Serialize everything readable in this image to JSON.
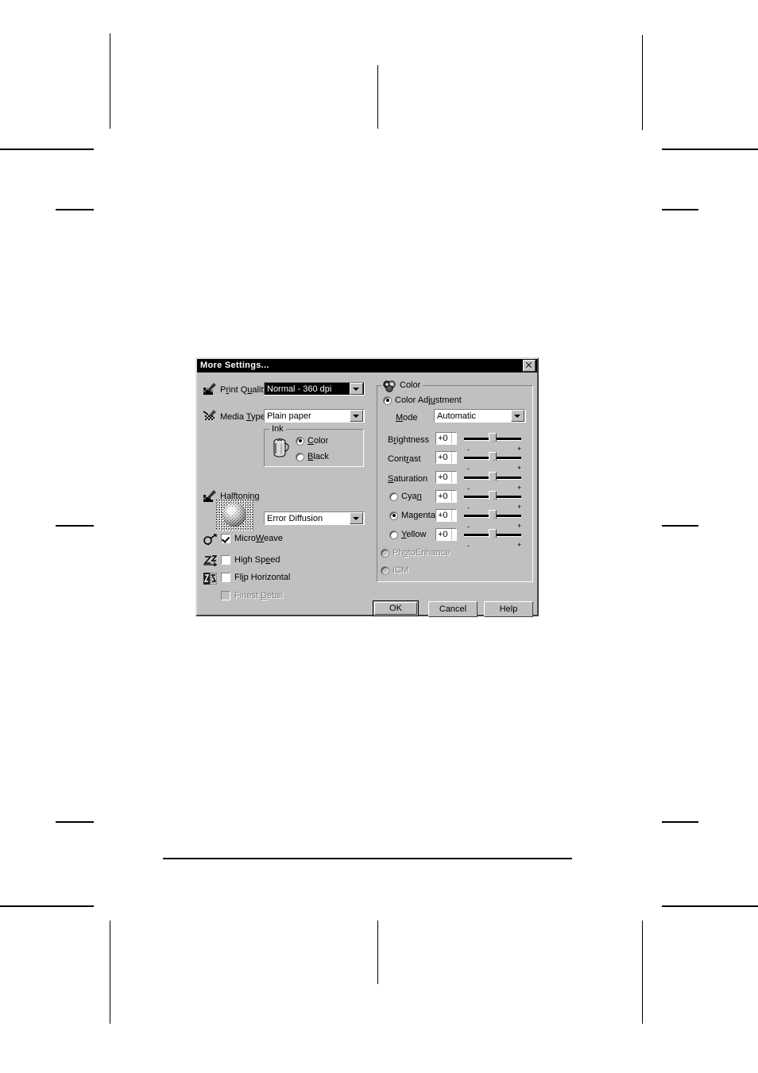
{
  "page": {
    "description": "Printed manual page showing an EPSON printer driver More Settings dialog",
    "background_color": "#ffffff",
    "mark_color": "#000000"
  },
  "dialog": {
    "title": "More Settings...",
    "close_label": "×",
    "background_color": "#c0c0c0",
    "titlebar_color": "#000000",
    "titlebar_text_color": "#ffffff",
    "left_panel": {
      "print_quality": {
        "label": "Print Quality",
        "value": "Normal - 360 dpi",
        "selected": true,
        "icon": "print-quality-icon"
      },
      "media_type": {
        "label": "Media Type",
        "value": "Plain paper",
        "icon": "media-type-icon"
      },
      "ink": {
        "group_label": "Ink",
        "icon": "ink-bottle-icon",
        "options": [
          {
            "label": "Color",
            "checked": true
          },
          {
            "label": "Black",
            "checked": false
          }
        ]
      },
      "halftoning": {
        "label": "Halftoning",
        "value": "Error Diffusion",
        "icon": "halftoning-icon"
      },
      "checkboxes": [
        {
          "label": "MicroWeave",
          "checked": true,
          "disabled": false,
          "icon": "microweave-icon"
        },
        {
          "label": "High Speed",
          "checked": false,
          "disabled": false,
          "icon": "high-speed-icon"
        },
        {
          "label": "Flip Horizontal",
          "checked": false,
          "disabled": false,
          "icon": "flip-horizontal-icon"
        },
        {
          "label": "Finest Detail",
          "checked": false,
          "disabled": true,
          "icon": null
        }
      ]
    },
    "color_panel": {
      "group_label": "Color",
      "group_icon": "color-circles-icon",
      "color_adjustment": {
        "label": "Color Adjustment",
        "checked": true
      },
      "mode": {
        "label": "Mode",
        "value": "Automatic"
      },
      "sliders": [
        {
          "label": "Brightness",
          "value": "+0",
          "kind": "label",
          "minus": "-",
          "plus": "+"
        },
        {
          "label": "Contrast",
          "value": "+0",
          "kind": "label",
          "minus": "-",
          "plus": "+"
        },
        {
          "label": "Saturation",
          "value": "+0",
          "kind": "label",
          "minus": "-",
          "plus": "+"
        },
        {
          "label": "Cyan",
          "value": "+0",
          "kind": "radio",
          "checked": false,
          "minus": "-",
          "plus": "+"
        },
        {
          "label": "Magenta",
          "value": "+0",
          "kind": "radio",
          "checked": true,
          "minus": "-",
          "plus": "+"
        },
        {
          "label": "Yellow",
          "value": "+0",
          "kind": "radio",
          "checked": false,
          "minus": "-",
          "plus": "+"
        }
      ],
      "photo_enhance": {
        "label": "PhotoEnhance",
        "checked": false,
        "disabled": true
      },
      "icm": {
        "label": "ICM",
        "checked": false,
        "disabled": true
      }
    },
    "buttons": [
      {
        "label": "OK",
        "default": true
      },
      {
        "label": "Cancel",
        "default": false
      },
      {
        "label": "Help",
        "default": false
      }
    ]
  }
}
